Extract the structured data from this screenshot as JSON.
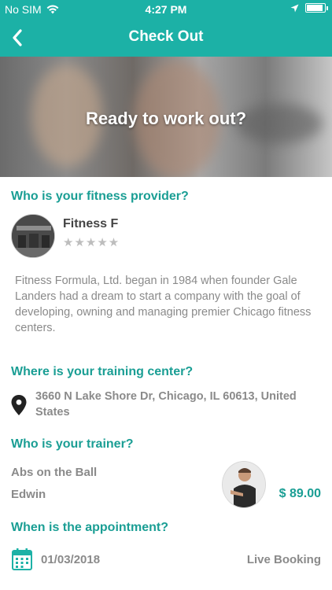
{
  "status_bar": {
    "carrier": "No SIM",
    "time": "4:27 PM"
  },
  "nav": {
    "title": "Check Out",
    "back_icon": "chevron-left-icon"
  },
  "hero": {
    "title": "Ready to work out?"
  },
  "provider": {
    "heading": "Who is your fitness provider?",
    "name": "Fitness F",
    "stars": "★★★★★",
    "description": "Fitness Formula, Ltd. began in 1984 when founder Gale Landers had a dream to start a company with the goal of developing, owning and managing premier Chicago fitness centers."
  },
  "location": {
    "heading": "Where is your training center?",
    "address": "3660 N Lake Shore Dr, Chicago, IL 60613, United States"
  },
  "trainer": {
    "heading": "Who is your trainer?",
    "class_name": "Abs on the Ball",
    "name": "Edwin",
    "price": "$ 89.00"
  },
  "appointment": {
    "heading": "When is the appointment?",
    "date": "01/03/2018",
    "booking_type": "Live Booking"
  },
  "colors": {
    "accent": "#1cb1a6",
    "heading": "#1a9e94",
    "text_muted": "#8a8a8a"
  }
}
